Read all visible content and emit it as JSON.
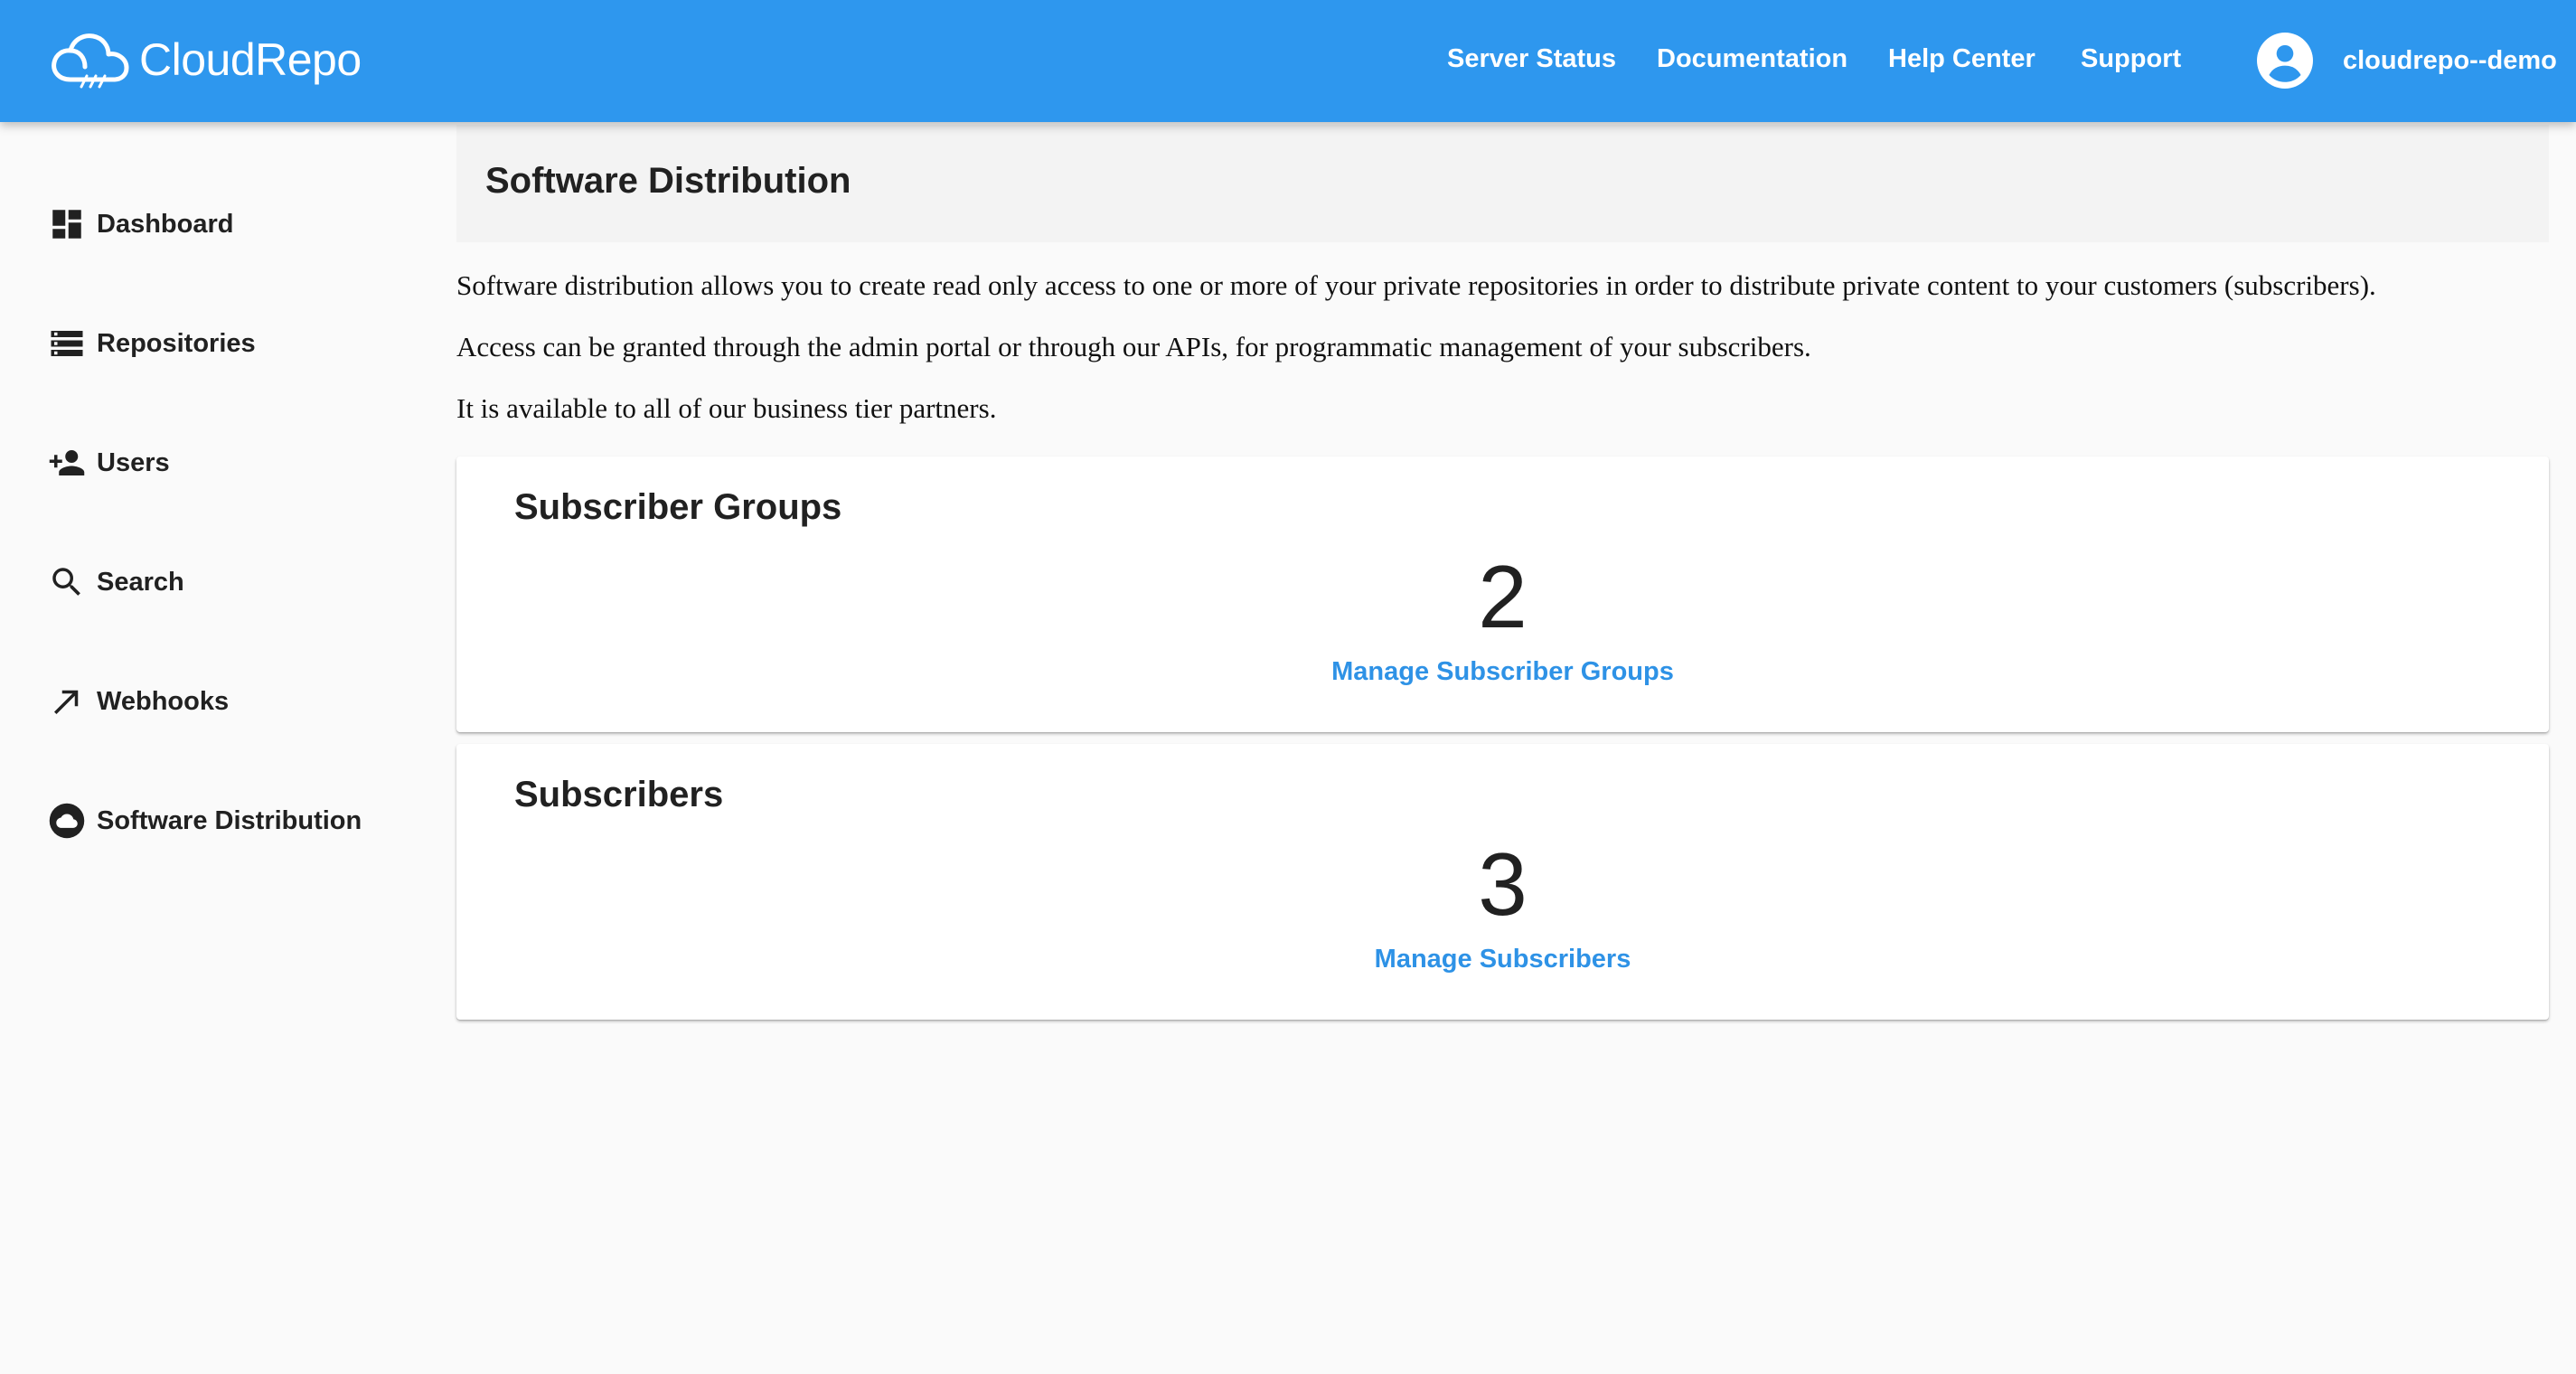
{
  "header": {
    "brand": "CloudRepo",
    "nav": [
      {
        "label": "Server Status"
      },
      {
        "label": "Documentation"
      },
      {
        "label": "Help Center"
      },
      {
        "label": "Support"
      }
    ],
    "username": "cloudrepo--demo"
  },
  "sidebar": {
    "items": [
      {
        "label": "Dashboard",
        "icon": "dashboard-icon"
      },
      {
        "label": "Repositories",
        "icon": "storage-icon"
      },
      {
        "label": "Users",
        "icon": "person-add-icon"
      },
      {
        "label": "Search",
        "icon": "search-icon"
      },
      {
        "label": "Webhooks",
        "icon": "arrow-up-right-icon"
      },
      {
        "label": "Software Distribution",
        "icon": "cloud-icon"
      }
    ]
  },
  "main": {
    "title": "Software Distribution",
    "paragraphs": [
      "Software distribution allows you to create read only access to one or more of your private repositories in order to distribute private content to your customers (subscribers).",
      "Access can be granted through the admin portal or through our APIs, for programmatic management of your subscribers.",
      "It is available to all of our business tier partners."
    ],
    "cards": [
      {
        "title": "Subscriber Groups",
        "count": "2",
        "link": "Manage Subscriber Groups"
      },
      {
        "title": "Subscribers",
        "count": "3",
        "link": "Manage Subscribers"
      }
    ]
  },
  "colors": {
    "appbar": "#2e97ee",
    "link": "#2e92e6",
    "background": "#fafafa"
  }
}
